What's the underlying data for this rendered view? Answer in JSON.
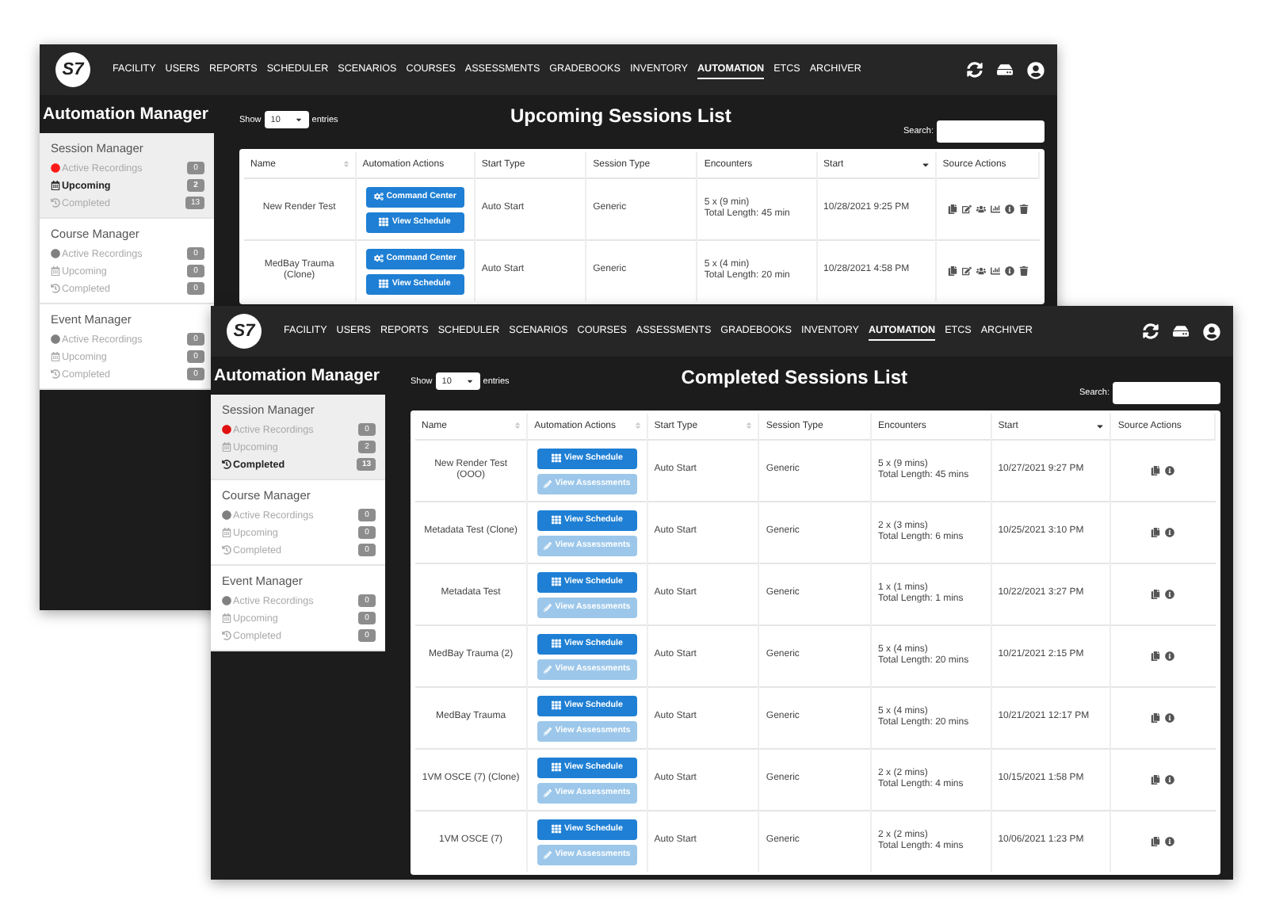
{
  "windows": [
    {
      "logo": "S7",
      "nav": [
        {
          "label": "FACILITY",
          "selected": false
        },
        {
          "label": "USERS",
          "selected": false
        },
        {
          "label": "REPORTS",
          "selected": false
        },
        {
          "label": "SCHEDULER",
          "selected": false
        },
        {
          "label": "SCENARIOS",
          "selected": false
        },
        {
          "label": "COURSES",
          "selected": false
        },
        {
          "label": "ASSESSMENTS",
          "selected": false
        },
        {
          "label": "GRADEBOOKS",
          "selected": false
        },
        {
          "label": "INVENTORY",
          "selected": false
        },
        {
          "label": "AUTOMATION",
          "selected": true
        },
        {
          "label": "ETCS",
          "selected": false
        },
        {
          "label": "ARCHIVER",
          "selected": false
        }
      ],
      "sidebar": {
        "title": "Automation Manager",
        "sections": [
          {
            "title": "Session Manager",
            "items": [
              {
                "kind": "recordings",
                "label": "Active Recordings",
                "count": "0",
                "selected": false,
                "color": "#ff1a1a"
              },
              {
                "kind": "upcoming",
                "label": "Upcoming",
                "count": "2",
                "selected": true
              },
              {
                "kind": "completed",
                "label": "Completed",
                "count": "13",
                "selected": false
              }
            ]
          },
          {
            "title": "Course Manager",
            "items": [
              {
                "kind": "recordings",
                "label": "Active Recordings",
                "count": "0",
                "selected": false,
                "color": "#808080"
              },
              {
                "kind": "upcoming",
                "label": "Upcoming",
                "count": "0",
                "selected": false
              },
              {
                "kind": "completed",
                "label": "Completed",
                "count": "0",
                "selected": false
              }
            ]
          },
          {
            "title": "Event Manager",
            "items": [
              {
                "kind": "recordings",
                "label": "Active Recordings",
                "count": "0",
                "selected": false,
                "color": "#808080"
              },
              {
                "kind": "upcoming",
                "label": "Upcoming",
                "count": "0",
                "selected": false
              },
              {
                "kind": "completed",
                "label": "Completed",
                "count": "0",
                "selected": false
              }
            ]
          }
        ]
      },
      "list": {
        "kind": "upcoming",
        "title": "Upcoming Sessions List",
        "show_label": "Show",
        "page_size": "10",
        "entries_label": "entries",
        "search_label": "Search:",
        "columns": [
          {
            "label": "Name",
            "sortable": true,
            "sorted": false
          },
          {
            "label": "Automation Actions",
            "sortable": false,
            "sorted": false
          },
          {
            "label": "Start Type",
            "sortable": false,
            "sorted": false
          },
          {
            "label": "Session Type",
            "sortable": false,
            "sorted": false
          },
          {
            "label": "Encounters",
            "sortable": false,
            "sorted": false
          },
          {
            "label": "Start",
            "sorted": true
          },
          {
            "label": "Source Actions",
            "sortable": false,
            "sorted": false
          }
        ],
        "rows": [
          {
            "name": "New Render Test",
            "actions": [
              {
                "kind": "command",
                "label": "Command Center",
                "disabled": false
              },
              {
                "kind": "schedule",
                "label": "View Schedule",
                "disabled": false
              }
            ],
            "start_type": "Auto Start",
            "session_type": "Generic",
            "encounters": [
              "5 x (9 min)",
              "Total Length: 45 min"
            ],
            "start": "10/28/2021 9:25 PM"
          },
          {
            "name": "MedBay Trauma (Clone)",
            "actions": [
              {
                "kind": "command",
                "label": "Command Center",
                "disabled": false
              },
              {
                "kind": "schedule",
                "label": "View Schedule",
                "disabled": false
              }
            ],
            "start_type": "Auto Start",
            "session_type": "Generic",
            "encounters": [
              "5 x (4 min)",
              "Total Length: 20 min"
            ],
            "start": "10/28/2021 4:58 PM"
          }
        ]
      }
    },
    {
      "logo": "S7",
      "nav": [
        {
          "label": "FACILITY",
          "selected": false
        },
        {
          "label": "USERS",
          "selected": false
        },
        {
          "label": "REPORTS",
          "selected": false
        },
        {
          "label": "SCHEDULER",
          "selected": false
        },
        {
          "label": "SCENARIOS",
          "selected": false
        },
        {
          "label": "COURSES",
          "selected": false
        },
        {
          "label": "ASSESSMENTS",
          "selected": false
        },
        {
          "label": "GRADEBOOKS",
          "selected": false
        },
        {
          "label": "INVENTORY",
          "selected": false
        },
        {
          "label": "AUTOMATION",
          "selected": true
        },
        {
          "label": "ETCS",
          "selected": false
        },
        {
          "label": "ARCHIVER",
          "selected": false
        }
      ],
      "sidebar": {
        "title": "Automation Manager",
        "sections": [
          {
            "title": "Session Manager",
            "items": [
              {
                "kind": "recordings",
                "label": "Active Recordings",
                "count": "0",
                "selected": false,
                "color": "#e01010"
              },
              {
                "kind": "upcoming",
                "label": "Upcoming",
                "count": "2",
                "selected": false
              },
              {
                "kind": "completed",
                "label": "Completed",
                "count": "13",
                "selected": true
              }
            ]
          },
          {
            "title": "Course Manager",
            "items": [
              {
                "kind": "recordings",
                "label": "Active Recordings",
                "count": "0",
                "selected": false,
                "color": "#808080"
              },
              {
                "kind": "upcoming",
                "label": "Upcoming",
                "count": "0",
                "selected": false
              },
              {
                "kind": "completed",
                "label": "Completed",
                "count": "0",
                "selected": false
              }
            ]
          },
          {
            "title": "Event Manager",
            "items": [
              {
                "kind": "recordings",
                "label": "Active Recordings",
                "count": "0",
                "selected": false,
                "color": "#808080"
              },
              {
                "kind": "upcoming",
                "label": "Upcoming",
                "count": "0",
                "selected": false
              },
              {
                "kind": "completed",
                "label": "Completed",
                "count": "0",
                "selected": false
              }
            ]
          }
        ]
      },
      "list": {
        "kind": "completed",
        "title": "Completed Sessions List",
        "show_label": "Show",
        "page_size": "10",
        "entries_label": "entries",
        "search_label": "Search:",
        "columns": [
          {
            "label": "Name",
            "sortable": true,
            "sorted": false
          },
          {
            "label": "Automation Actions",
            "sortable": true,
            "sorted": false
          },
          {
            "label": "Start Type",
            "sortable": true,
            "sorted": false
          },
          {
            "label": "Session Type",
            "sortable": false,
            "sorted": false
          },
          {
            "label": "Encounters",
            "sortable": false,
            "sorted": false
          },
          {
            "label": "Start",
            "sorted": true
          },
          {
            "label": "Source Actions",
            "sortable": false,
            "sorted": false
          }
        ],
        "rows": [
          {
            "name": "New Render Test (OOO)",
            "actions": [
              {
                "kind": "schedule",
                "label": "View Schedule",
                "disabled": false
              },
              {
                "kind": "assessments",
                "label": "View Assessments",
                "disabled": true
              }
            ],
            "start_type": "Auto Start",
            "session_type": "Generic",
            "encounters": [
              "5 x (9 mins)",
              "Total Length: 45 mins"
            ],
            "start": "10/27/2021 9:27 PM"
          },
          {
            "name": "Metadata Test (Clone)",
            "actions": [
              {
                "kind": "schedule",
                "label": "View Schedule",
                "disabled": false
              },
              {
                "kind": "assessments",
                "label": "View Assessments",
                "disabled": true
              }
            ],
            "start_type": "Auto Start",
            "session_type": "Generic",
            "encounters": [
              "2 x (3 mins)",
              "Total Length: 6 mins"
            ],
            "start": "10/25/2021 3:10 PM"
          },
          {
            "name": "Metadata Test",
            "actions": [
              {
                "kind": "schedule",
                "label": "View Schedule",
                "disabled": false
              },
              {
                "kind": "assessments",
                "label": "View Assessments",
                "disabled": true
              }
            ],
            "start_type": "Auto Start",
            "session_type": "Generic",
            "encounters": [
              "1 x (1 mins)",
              "Total Length: 1 mins"
            ],
            "start": "10/22/2021 3:27 PM"
          },
          {
            "name": "MedBay Trauma (2)",
            "actions": [
              {
                "kind": "schedule",
                "label": "View Schedule",
                "disabled": false
              },
              {
                "kind": "assessments",
                "label": "View Assessments",
                "disabled": true
              }
            ],
            "start_type": "Auto Start",
            "session_type": "Generic",
            "encounters": [
              "5 x (4 mins)",
              "Total Length: 20 mins"
            ],
            "start": "10/21/2021 2:15 PM"
          },
          {
            "name": "MedBay Trauma",
            "actions": [
              {
                "kind": "schedule",
                "label": "View Schedule",
                "disabled": false
              },
              {
                "kind": "assessments",
                "label": "View Assessments",
                "disabled": true
              }
            ],
            "start_type": "Auto Start",
            "session_type": "Generic",
            "encounters": [
              "5 x (4 mins)",
              "Total Length: 20 mins"
            ],
            "start": "10/21/2021 12:17 PM"
          },
          {
            "name": "1VM OSCE (7) (Clone)",
            "actions": [
              {
                "kind": "schedule",
                "label": "View Schedule",
                "disabled": false
              },
              {
                "kind": "assessments",
                "label": "View Assessments",
                "disabled": true
              }
            ],
            "start_type": "Auto Start",
            "session_type": "Generic",
            "encounters": [
              "2 x (2 mins)",
              "Total Length: 4 mins"
            ],
            "start": "10/15/2021 1:58 PM"
          },
          {
            "name": "1VM OSCE (7)",
            "actions": [
              {
                "kind": "schedule",
                "label": "View Schedule",
                "disabled": false
              },
              {
                "kind": "assessments",
                "label": "View Assessments",
                "disabled": true
              }
            ],
            "start_type": "Auto Start",
            "session_type": "Generic",
            "encounters": [
              "2 x (2 mins)",
              "Total Length: 4 mins"
            ],
            "start": "10/06/2021 1:23 PM"
          }
        ]
      }
    }
  ]
}
